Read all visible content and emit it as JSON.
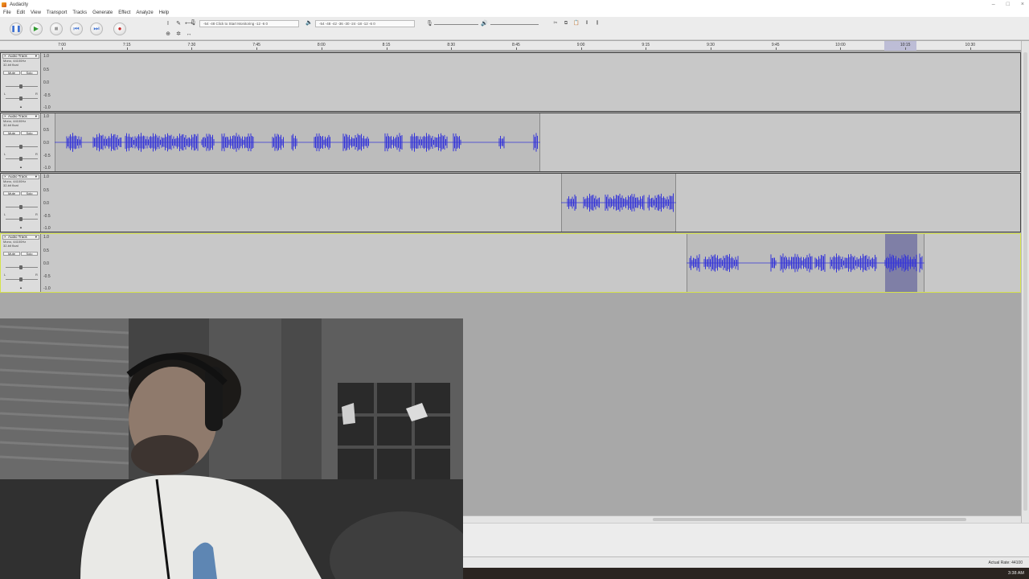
{
  "window": {
    "title": "Audacity",
    "minimize": "–",
    "maximize": "□",
    "close": "×"
  },
  "menu": [
    "File",
    "Edit",
    "View",
    "Transport",
    "Tracks",
    "Generate",
    "Effect",
    "Analyze",
    "Help"
  ],
  "toolbar": {
    "transport": [
      {
        "name": "pause-button",
        "icon": "❚❚",
        "color": "#3b6fd1"
      },
      {
        "name": "play-button",
        "icon": "▶",
        "color": "#2f9a2f"
      },
      {
        "name": "stop-button",
        "icon": "■",
        "color": "#999999"
      },
      {
        "name": "skip-start-button",
        "icon": "⏮",
        "color": "#3b6fd1"
      },
      {
        "name": "skip-end-button",
        "icon": "⏭",
        "color": "#3b6fd1"
      },
      {
        "name": "record-button",
        "icon": "●",
        "color": "#c42424"
      }
    ],
    "tools": [
      "I",
      "✎",
      "⟷",
      "⊕",
      "✲",
      "↔"
    ],
    "record_meter": "-54   -48   Click to Start Monitoring   -12   -6   0",
    "play_meter": "-54   -48   -42   -36   -30   -24   -18   -12   -6   0"
  },
  "ruler": {
    "labels": [
      "7:00",
      "7:15",
      "7:30",
      "7:45",
      "8:00",
      "8:15",
      "8:30",
      "8:45",
      "9:00",
      "9:15",
      "9:30",
      "9:45",
      "10:00",
      "10:15",
      "10:30"
    ]
  },
  "tracks": [
    {
      "name": "Audio Track",
      "info": "Mono, 44100Hz\n32-bit float",
      "mute": "Mute",
      "solo": "Solo",
      "scale": [
        "1.0",
        "0.5",
        "0.0",
        "-0.5",
        "-1.0"
      ],
      "selected": false
    },
    {
      "name": "Audio Track",
      "info": "Mono, 44100Hz\n32-bit float",
      "mute": "Mute",
      "solo": "Solo",
      "scale": [
        "1.0",
        "0.5",
        "0.0",
        "-0.5",
        "-1.0"
      ],
      "selected": false
    },
    {
      "name": "Audio Track",
      "info": "Mono, 44100Hz\n32-bit float",
      "mute": "Mute",
      "solo": "Solo",
      "scale": [
        "1.0",
        "0.5",
        "0.0",
        "-0.5",
        "-1.0"
      ],
      "selected": false
    },
    {
      "name": "Audio Track",
      "info": "Mono, 44100Hz\n32-bit float",
      "mute": "Mute",
      "solo": "Solo",
      "scale": [
        "1.0",
        "0.5",
        "0.0",
        "-0.5",
        "-1.0"
      ],
      "selected": true
    }
  ],
  "status": {
    "rate": "Actual Rate: 44100",
    "clock": "3:38 AM"
  },
  "colors": {
    "waveform": "#3535d8",
    "selection": "#7f7fa6",
    "track_bg": "#c8c8c8",
    "clip_bg": "#bcbcbc"
  }
}
